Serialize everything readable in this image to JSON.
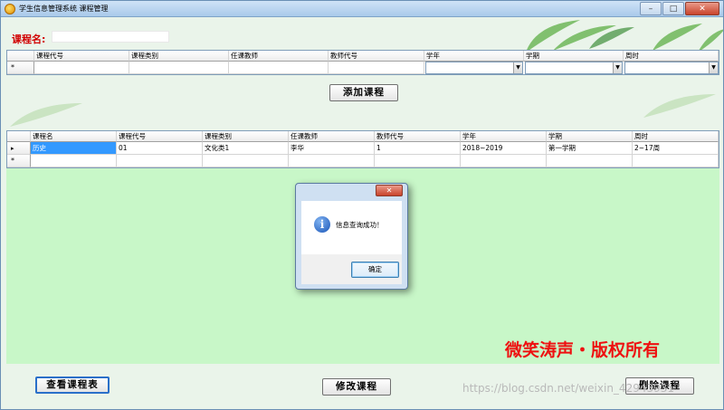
{
  "window": {
    "title": "学生信息管理系统  课程管理",
    "controls": {
      "minimize": "–",
      "maximize": "□",
      "close": "✕"
    }
  },
  "form": {
    "course_name_label": "课程名:",
    "course_name_value": ""
  },
  "input_grid": {
    "columns": [
      "课程代号",
      "课程类别",
      "任课教师",
      "教师代号",
      "学年",
      "学期",
      "周时"
    ],
    "new_row_marker": "*"
  },
  "buttons": {
    "add_course": "添加课程",
    "view_schedule": "查看课程表",
    "edit_course": "修改课程",
    "delete_course": "删除课程"
  },
  "result_grid": {
    "columns": [
      "课程名",
      "课程代号",
      "课程类别",
      "任课教师",
      "教师代号",
      "学年",
      "学期",
      "周时"
    ],
    "rows": [
      {
        "marker": "▸",
        "cells": [
          "历史",
          "01",
          "文化类1",
          "李华",
          "1",
          "2018~2019",
          "第一学期",
          "2~17周"
        ]
      }
    ],
    "new_row_marker": "*"
  },
  "dialog": {
    "message": "信息查询成功！",
    "ok_label": "确定",
    "close_label": "✕",
    "icon": "info-icon"
  },
  "watermarks": {
    "copyright": "微笑涛声・版权所有",
    "url": "https://blog.csdn.net/weixin_42943931"
  },
  "colors": {
    "title_red": "#d10000",
    "selection": "#3399ff",
    "grid_background": "#c8f7c8"
  }
}
